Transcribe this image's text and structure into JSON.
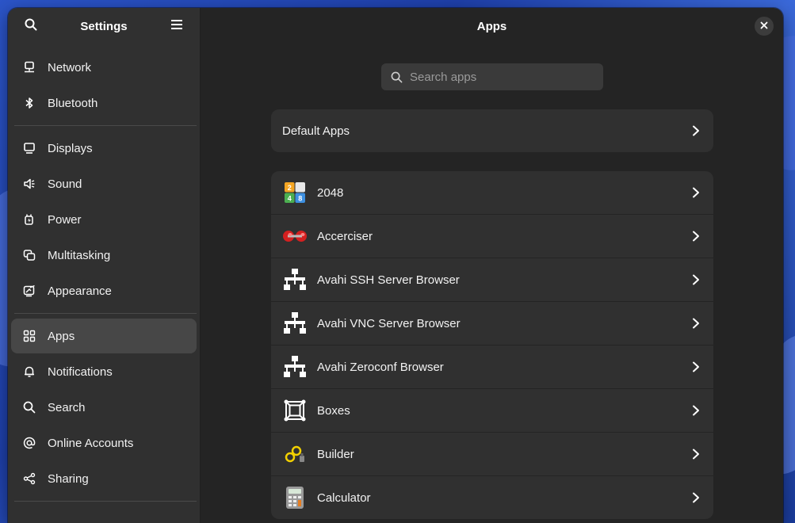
{
  "sidebar": {
    "title": "Settings",
    "search_icon": "search-icon",
    "menu_icon": "hamburger-menu-icon",
    "groups": [
      [
        {
          "label": "Network",
          "icon": "network-icon"
        },
        {
          "label": "Bluetooth",
          "icon": "bluetooth-icon"
        }
      ],
      [
        {
          "label": "Displays",
          "icon": "display-icon"
        },
        {
          "label": "Sound",
          "icon": "speaker-icon"
        },
        {
          "label": "Power",
          "icon": "power-plug-icon"
        },
        {
          "label": "Multitasking",
          "icon": "multitasking-icon"
        },
        {
          "label": "Appearance",
          "icon": "appearance-icon"
        }
      ],
      [
        {
          "label": "Apps",
          "icon": "apps-grid-icon",
          "selected": true
        },
        {
          "label": "Notifications",
          "icon": "bell-icon"
        },
        {
          "label": "Search",
          "icon": "search-icon"
        },
        {
          "label": "Online Accounts",
          "icon": "at-sign-icon"
        },
        {
          "label": "Sharing",
          "icon": "share-icon"
        }
      ]
    ]
  },
  "main": {
    "title": "Apps",
    "search": {
      "placeholder": "Search apps",
      "value": ""
    },
    "default_apps": {
      "label": "Default Apps"
    },
    "apps": [
      {
        "label": "2048",
        "icon": "app-2048-icon"
      },
      {
        "label": "Accerciser",
        "icon": "accerciser-icon"
      },
      {
        "label": "Avahi SSH Server Browser",
        "icon": "network-tree-icon"
      },
      {
        "label": "Avahi VNC Server Browser",
        "icon": "network-tree-icon"
      },
      {
        "label": "Avahi Zeroconf Browser",
        "icon": "network-tree-icon"
      },
      {
        "label": "Boxes",
        "icon": "boxes-icon"
      },
      {
        "label": "Builder",
        "icon": "builder-icon"
      },
      {
        "label": "Calculator",
        "icon": "calculator-icon"
      }
    ]
  },
  "colors": {
    "sidebar_bg": "#303030",
    "main_bg": "#242424",
    "card_bg": "#303030",
    "selected_bg": "#474747"
  }
}
